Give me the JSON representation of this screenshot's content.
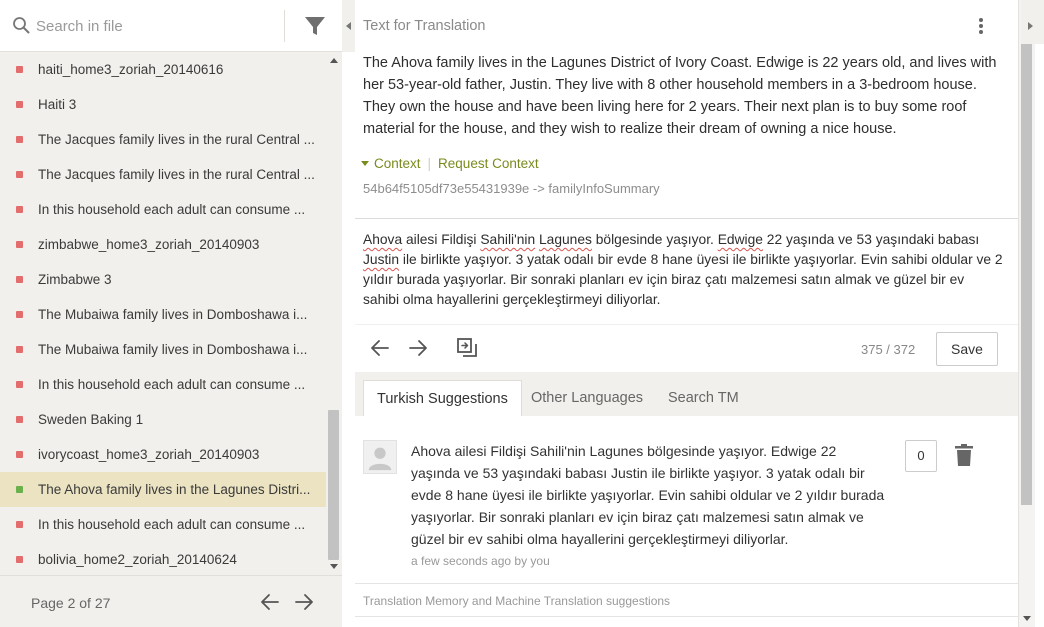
{
  "search": {
    "placeholder": "Search in file"
  },
  "files": [
    {
      "label": "haiti_home3_zoriah_20140616",
      "status": "untranslated"
    },
    {
      "label": "Haiti 3",
      "status": "untranslated"
    },
    {
      "label": "The Jacques family lives in the rural Central ...",
      "status": "untranslated"
    },
    {
      "label": "The Jacques family lives in the rural Central ...",
      "status": "untranslated"
    },
    {
      "label": "In this household each adult can consume ...",
      "status": "untranslated"
    },
    {
      "label": "zimbabwe_home3_zoriah_20140903",
      "status": "untranslated"
    },
    {
      "label": "Zimbabwe 3",
      "status": "untranslated"
    },
    {
      "label": "The Mubaiwa family lives in Domboshawa i...",
      "status": "untranslated"
    },
    {
      "label": "The Mubaiwa family lives in Domboshawa i...",
      "status": "untranslated"
    },
    {
      "label": "In this household each adult can consume ...",
      "status": "untranslated"
    },
    {
      "label": "Sweden Baking 1",
      "status": "untranslated"
    },
    {
      "label": "ivorycoast_home3_zoriah_20140903",
      "status": "untranslated"
    },
    {
      "label": "The Ahova family lives in the Lagunes Distri...",
      "status": "translated",
      "active": true
    },
    {
      "label": "In this household each adult can consume ...",
      "status": "untranslated"
    },
    {
      "label": "bolivia_home2_zoriah_20140624",
      "status": "untranslated"
    }
  ],
  "pager": {
    "label": "Page 2 of 27"
  },
  "source": {
    "title": "Text for Translation",
    "text": "The Ahova family lives in the Lagunes District of Ivory Coast. Edwige is 22 years old, and lives with her 53-year-old father, Justin. They live with 8 other household members in a 3-bedroom house. They own the house and have been living here for 2 years. Their next plan is to buy some roof material for the house, and they wish to realize their dream of owning a nice house.",
    "context_label": "Context",
    "request_context_label": "Request Context",
    "context_key": "54b64f5105df73e55431939e -> familyInfoSummary"
  },
  "translation": {
    "segments": [
      {
        "t": "Ahova",
        "s": true
      },
      {
        "t": " ailesi Fildişi ",
        "s": false
      },
      {
        "t": "Sahili'nin",
        "s": true
      },
      {
        "t": " ",
        "s": false
      },
      {
        "t": "Lagunes",
        "s": true
      },
      {
        "t": " bölgesinde yaşıyor. ",
        "s": false
      },
      {
        "t": "Edwige",
        "s": true
      },
      {
        "t": " 22 yaşında ve 53 yaşındaki babası ",
        "s": false
      },
      {
        "t": "Justin",
        "s": true
      },
      {
        "t": " ile birlikte yaşıyor. 3 yatak odalı bir evde 8 hane üyesi ile birlikte yaşıyorlar. Evin sahibi oldular ve 2 yıldır burada yaşıyorlar. Bir sonraki planları ev için biraz çatı malzemesi satın almak ve güzel bir ev sahibi olma hayallerini gerçekleştirmeyi diliyorlar.",
        "s": false
      }
    ],
    "counter": "375 / 372",
    "save_label": "Save"
  },
  "tabs": [
    {
      "label": "Turkish Suggestions",
      "active": true
    },
    {
      "label": "Other Languages",
      "active": false
    },
    {
      "label": "Search TM",
      "active": false
    }
  ],
  "suggestion": {
    "text": "Ahova ailesi Fildişi Sahili'nin Lagunes bölgesinde yaşıyor. Edwige 22 yaşında ve 53 yaşındaki babası Justin ile birlikte yaşıyor. 3 yatak odalı bir evde 8 hane üyesi ile birlikte yaşıyorlar. Evin sahibi oldular ve 2 yıldır burada yaşıyorlar. Bir sonraki planları ev için biraz çatı malzemesi satın almak ve güzel bir ev sahibi olma hayallerini gerçekleştirmeyi diliyorlar.",
    "meta": "a few seconds ago by you",
    "votes": "0"
  },
  "footer": {
    "note": "Translation Memory and Machine Translation suggestions"
  },
  "colors": {
    "accent": "#7b8a1e",
    "untranslated": "#e36c6c",
    "translated": "#6ab04c",
    "active_row": "#ebe3c2"
  }
}
